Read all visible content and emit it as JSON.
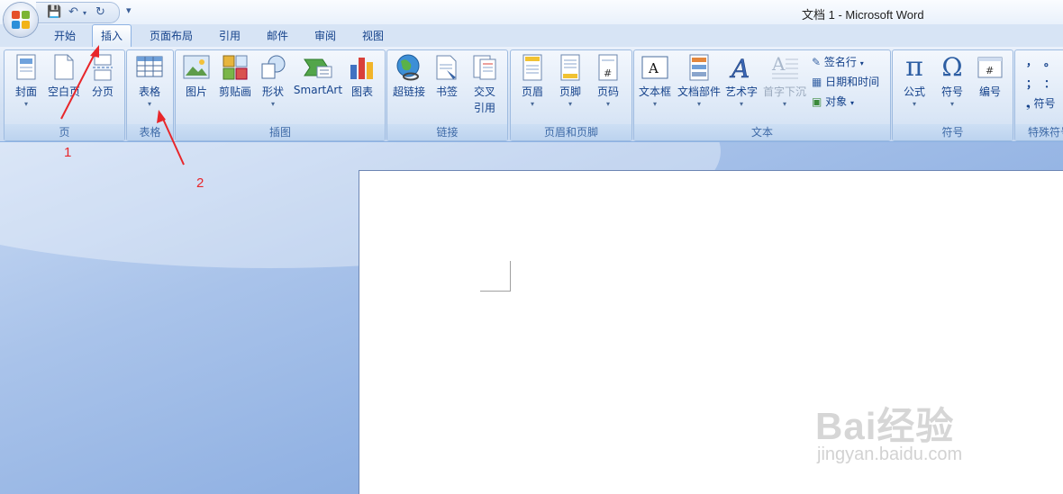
{
  "window": {
    "title": "文档 1 - Microsoft Word"
  },
  "tabs": [
    "开始",
    "插入",
    "页面布局",
    "引用",
    "邮件",
    "审阅",
    "视图"
  ],
  "active_tab": "插入",
  "groups": {
    "page": {
      "label": "页",
      "buttons": [
        "封面",
        "空白页",
        "分页"
      ]
    },
    "table": {
      "label": "表格",
      "buttons": [
        "表格"
      ]
    },
    "illustrations": {
      "label": "插图",
      "buttons": [
        "图片",
        "剪贴画",
        "形状",
        "SmartArt",
        "图表"
      ]
    },
    "links": {
      "label": "链接",
      "buttons": [
        "超链接",
        "书签",
        "交叉",
        "引用"
      ]
    },
    "header_footer": {
      "label": "页眉和页脚",
      "buttons": [
        "页眉",
        "页脚",
        "页码"
      ]
    },
    "text": {
      "label": "文本",
      "buttons": [
        "文本框",
        "文档部件",
        "艺术字",
        "首字下沉"
      ],
      "small": [
        "签名行",
        "日期和时间",
        "对象"
      ]
    },
    "symbols": {
      "label": "符号",
      "buttons": [
        "公式",
        "符号",
        "编号"
      ]
    },
    "special": {
      "label": "特殊符号",
      "items": [
        "，",
        "。",
        "；",
        "：",
        "符号"
      ]
    }
  },
  "annotations": {
    "arrow1": "1",
    "arrow2": "2"
  },
  "watermark": {
    "brand": "Bai经验",
    "url": "jingyan.baidu.com"
  },
  "colors": {
    "ribbon_text": "#15428b",
    "arrow": "#e8262a"
  }
}
